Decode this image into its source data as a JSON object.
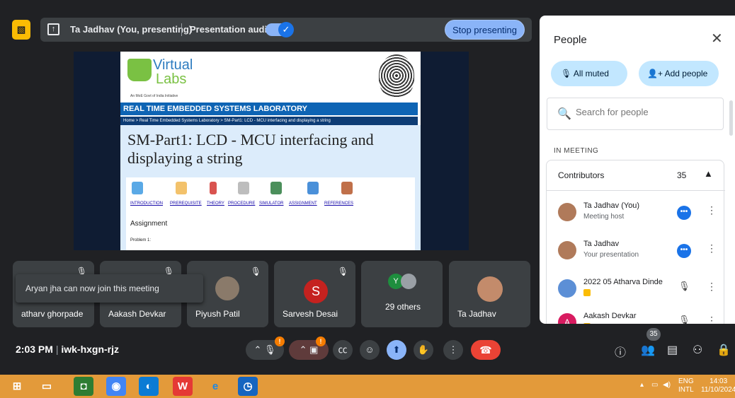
{
  "topbar": {
    "app_badge": "▧",
    "presenter": "Ta Jadhav (You, presenting)",
    "audio_label": "Presentation audio",
    "audio_toggle": "✓",
    "stop_label": "Stop presenting"
  },
  "shared_page": {
    "logo_line1": "Virtual",
    "logo_line2": "Labs",
    "logo_tagline": "An MoE Govt of India Initiative",
    "lab_title": "REAL TIME EMBEDDED SYSTEMS LABORATORY",
    "breadcrumb": "Home > Real Time Embedded Systems Laboratory > SM-Part1: LCD - MCU interfacing and displaying a string",
    "page_title": "SM-Part1: LCD - MCU interfacing and displaying a string",
    "tabs": [
      "INTRODUCTION",
      "PREREQUISITE",
      "THEORY",
      "PROCEDURE",
      "SIMULATOR",
      "ASSIGNMENT",
      "REFERENCES"
    ],
    "section_heading": "Assignment",
    "problem_label": "Problem 1:"
  },
  "tiles": [
    {
      "name": "atharv ghorpade"
    },
    {
      "name": "Aakash Devkar"
    },
    {
      "name": "Piyush Patil"
    },
    {
      "name": "Sarvesh Desai",
      "initial": "S"
    },
    {
      "name": "29 others",
      "initial": "Y"
    },
    {
      "name": "Ta Jadhav"
    }
  ],
  "toast": "Aryan jha can now join this meeting",
  "people_panel": {
    "title": "People",
    "all_muted": "All muted",
    "add_people": "Add people",
    "search_placeholder": "Search for people",
    "section_label": "IN MEETING",
    "contributors_label": "Contributors",
    "contributors_count": "35",
    "participants": [
      {
        "name": "Ta Jadhav (You)",
        "sub": "Meeting host",
        "action": "more"
      },
      {
        "name": "Ta Jadhav",
        "sub": "Your presentation",
        "action": "more"
      },
      {
        "name": "2022 05 Atharva Dinde",
        "sub": "",
        "action": "muted"
      },
      {
        "name": "Aakash Devkar",
        "sub": "",
        "action": "muted",
        "initial": "A"
      }
    ]
  },
  "bottom_bar": {
    "time": "2:03 PM",
    "meeting_code": "iwk-hxgn-rjz",
    "mic_badge": "!",
    "cam_badge": "!",
    "people_count": "35"
  },
  "taskbar": {
    "lang_line1": "ENG",
    "lang_line2": "INTL",
    "time": "14:03",
    "date": "11/10/2024"
  },
  "colors": {
    "accent_blue": "#8ab4f8",
    "end_call_red": "#ea4335",
    "taskbar_orange": "#e39a3a"
  }
}
